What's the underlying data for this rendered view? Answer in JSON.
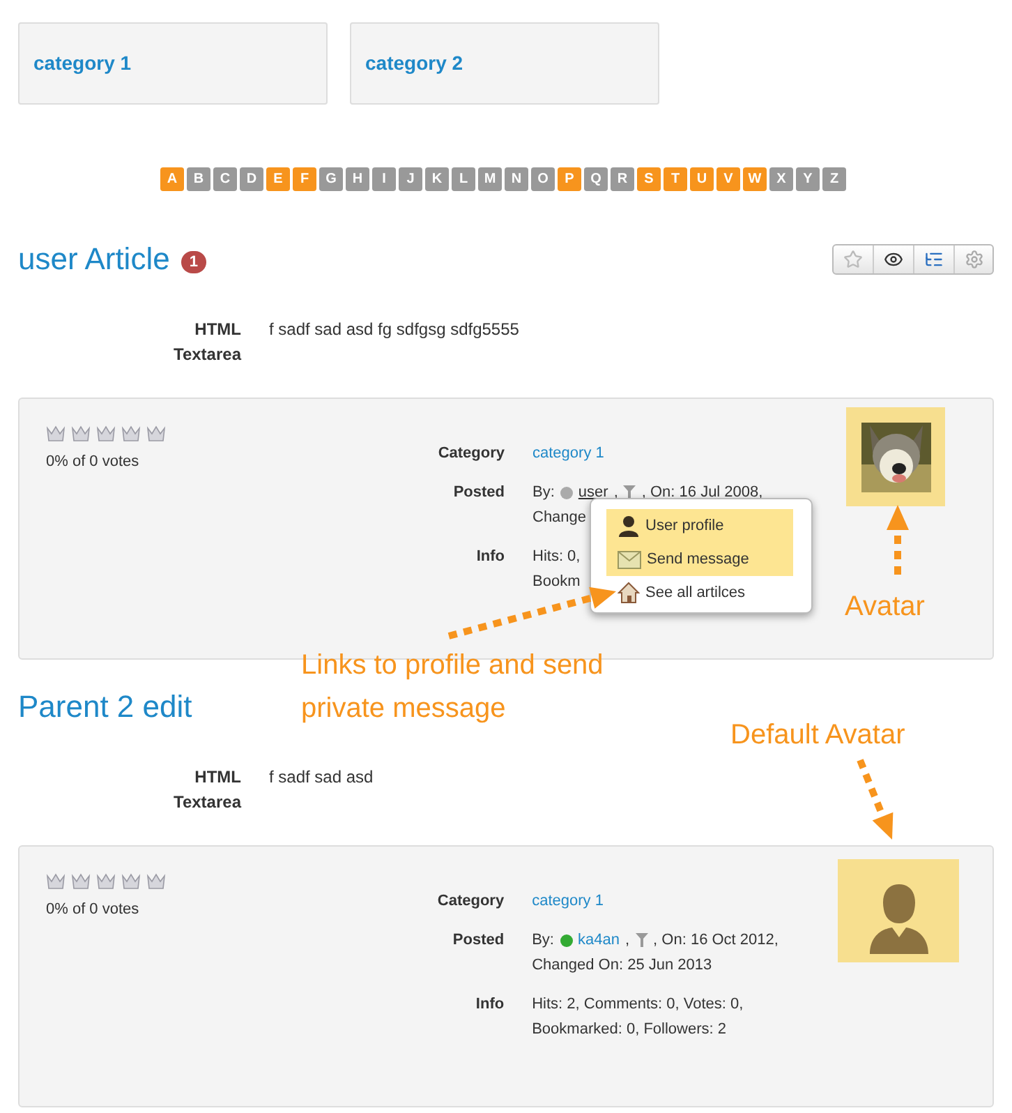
{
  "categories": [
    {
      "name": "category 1"
    },
    {
      "name": "category 2"
    }
  ],
  "letters": [
    {
      "letter": "A",
      "selected": true
    },
    {
      "letter": "B",
      "selected": false
    },
    {
      "letter": "C",
      "selected": false
    },
    {
      "letter": "D",
      "selected": false
    },
    {
      "letter": "E",
      "selected": true
    },
    {
      "letter": "F",
      "selected": true
    },
    {
      "letter": "G",
      "selected": false
    },
    {
      "letter": "H",
      "selected": false
    },
    {
      "letter": "I",
      "selected": false
    },
    {
      "letter": "J",
      "selected": false
    },
    {
      "letter": "K",
      "selected": false
    },
    {
      "letter": "L",
      "selected": false
    },
    {
      "letter": "M",
      "selected": false
    },
    {
      "letter": "N",
      "selected": false
    },
    {
      "letter": "O",
      "selected": false
    },
    {
      "letter": "P",
      "selected": true
    },
    {
      "letter": "Q",
      "selected": false
    },
    {
      "letter": "R",
      "selected": false
    },
    {
      "letter": "S",
      "selected": true
    },
    {
      "letter": "T",
      "selected": true
    },
    {
      "letter": "U",
      "selected": true
    },
    {
      "letter": "V",
      "selected": true
    },
    {
      "letter": "W",
      "selected": true
    },
    {
      "letter": "X",
      "selected": false
    },
    {
      "letter": "Y",
      "selected": false
    },
    {
      "letter": "Z",
      "selected": false
    }
  ],
  "articles": [
    {
      "title": "user Article",
      "badge": "1",
      "toolbar": true,
      "field": {
        "label": "HTML Textarea",
        "value": "f sadf sad asd fg sdfgsg sdfg5555"
      },
      "rating": {
        "stars": 0,
        "votes": "0% of 0 votes"
      },
      "category": {
        "label": "Category",
        "value": "category 1"
      },
      "posted": {
        "label": "Posted",
        "by": "By:",
        "online": false,
        "author": "user",
        "author_underlined": true,
        "after_author": ",",
        "on": ", On: 16 Jul 2008,",
        "line_2": "Change"
      },
      "info": {
        "label": "Info",
        "lines": [
          "Hits: 0,",
          "Bookm"
        ]
      },
      "popup": [
        {
          "kind": "profile",
          "label": "User profile",
          "highlighted": true
        },
        {
          "kind": "message",
          "label": "Send message",
          "highlighted": true
        },
        {
          "kind": "articles",
          "label": "See all artilces",
          "highlighted": false
        }
      ]
    },
    {
      "title": "Parent 2 edit",
      "toolbar": false,
      "field": {
        "label": "HTML Textarea",
        "value": "f sadf sad asd"
      },
      "rating": {
        "stars": 0,
        "votes": "0% of 0 votes"
      },
      "category": {
        "label": "Category",
        "value": "category 1"
      },
      "posted": {
        "label": "Posted",
        "by": "By:",
        "online": true,
        "author": "ka4an",
        "author_underlined": false,
        "after_author": ",",
        "on": ", On: 16 Oct 2012,",
        "line_2": "Changed On: 25 Jun 2013"
      },
      "info": {
        "label": "Info",
        "lines": [
          "Hits: 2, Comments: 0, Votes: 0,",
          "Bookmarked: 0, Followers: 2"
        ]
      },
      "avatar": {
        "kind": "default"
      }
    }
  ],
  "annotations": [
    {
      "kind": "avatar",
      "text": "Avatar"
    },
    {
      "kind": "links",
      "text": "Links to profile and send private message"
    },
    {
      "kind": "default",
      "text": "Default Avatar"
    }
  ]
}
